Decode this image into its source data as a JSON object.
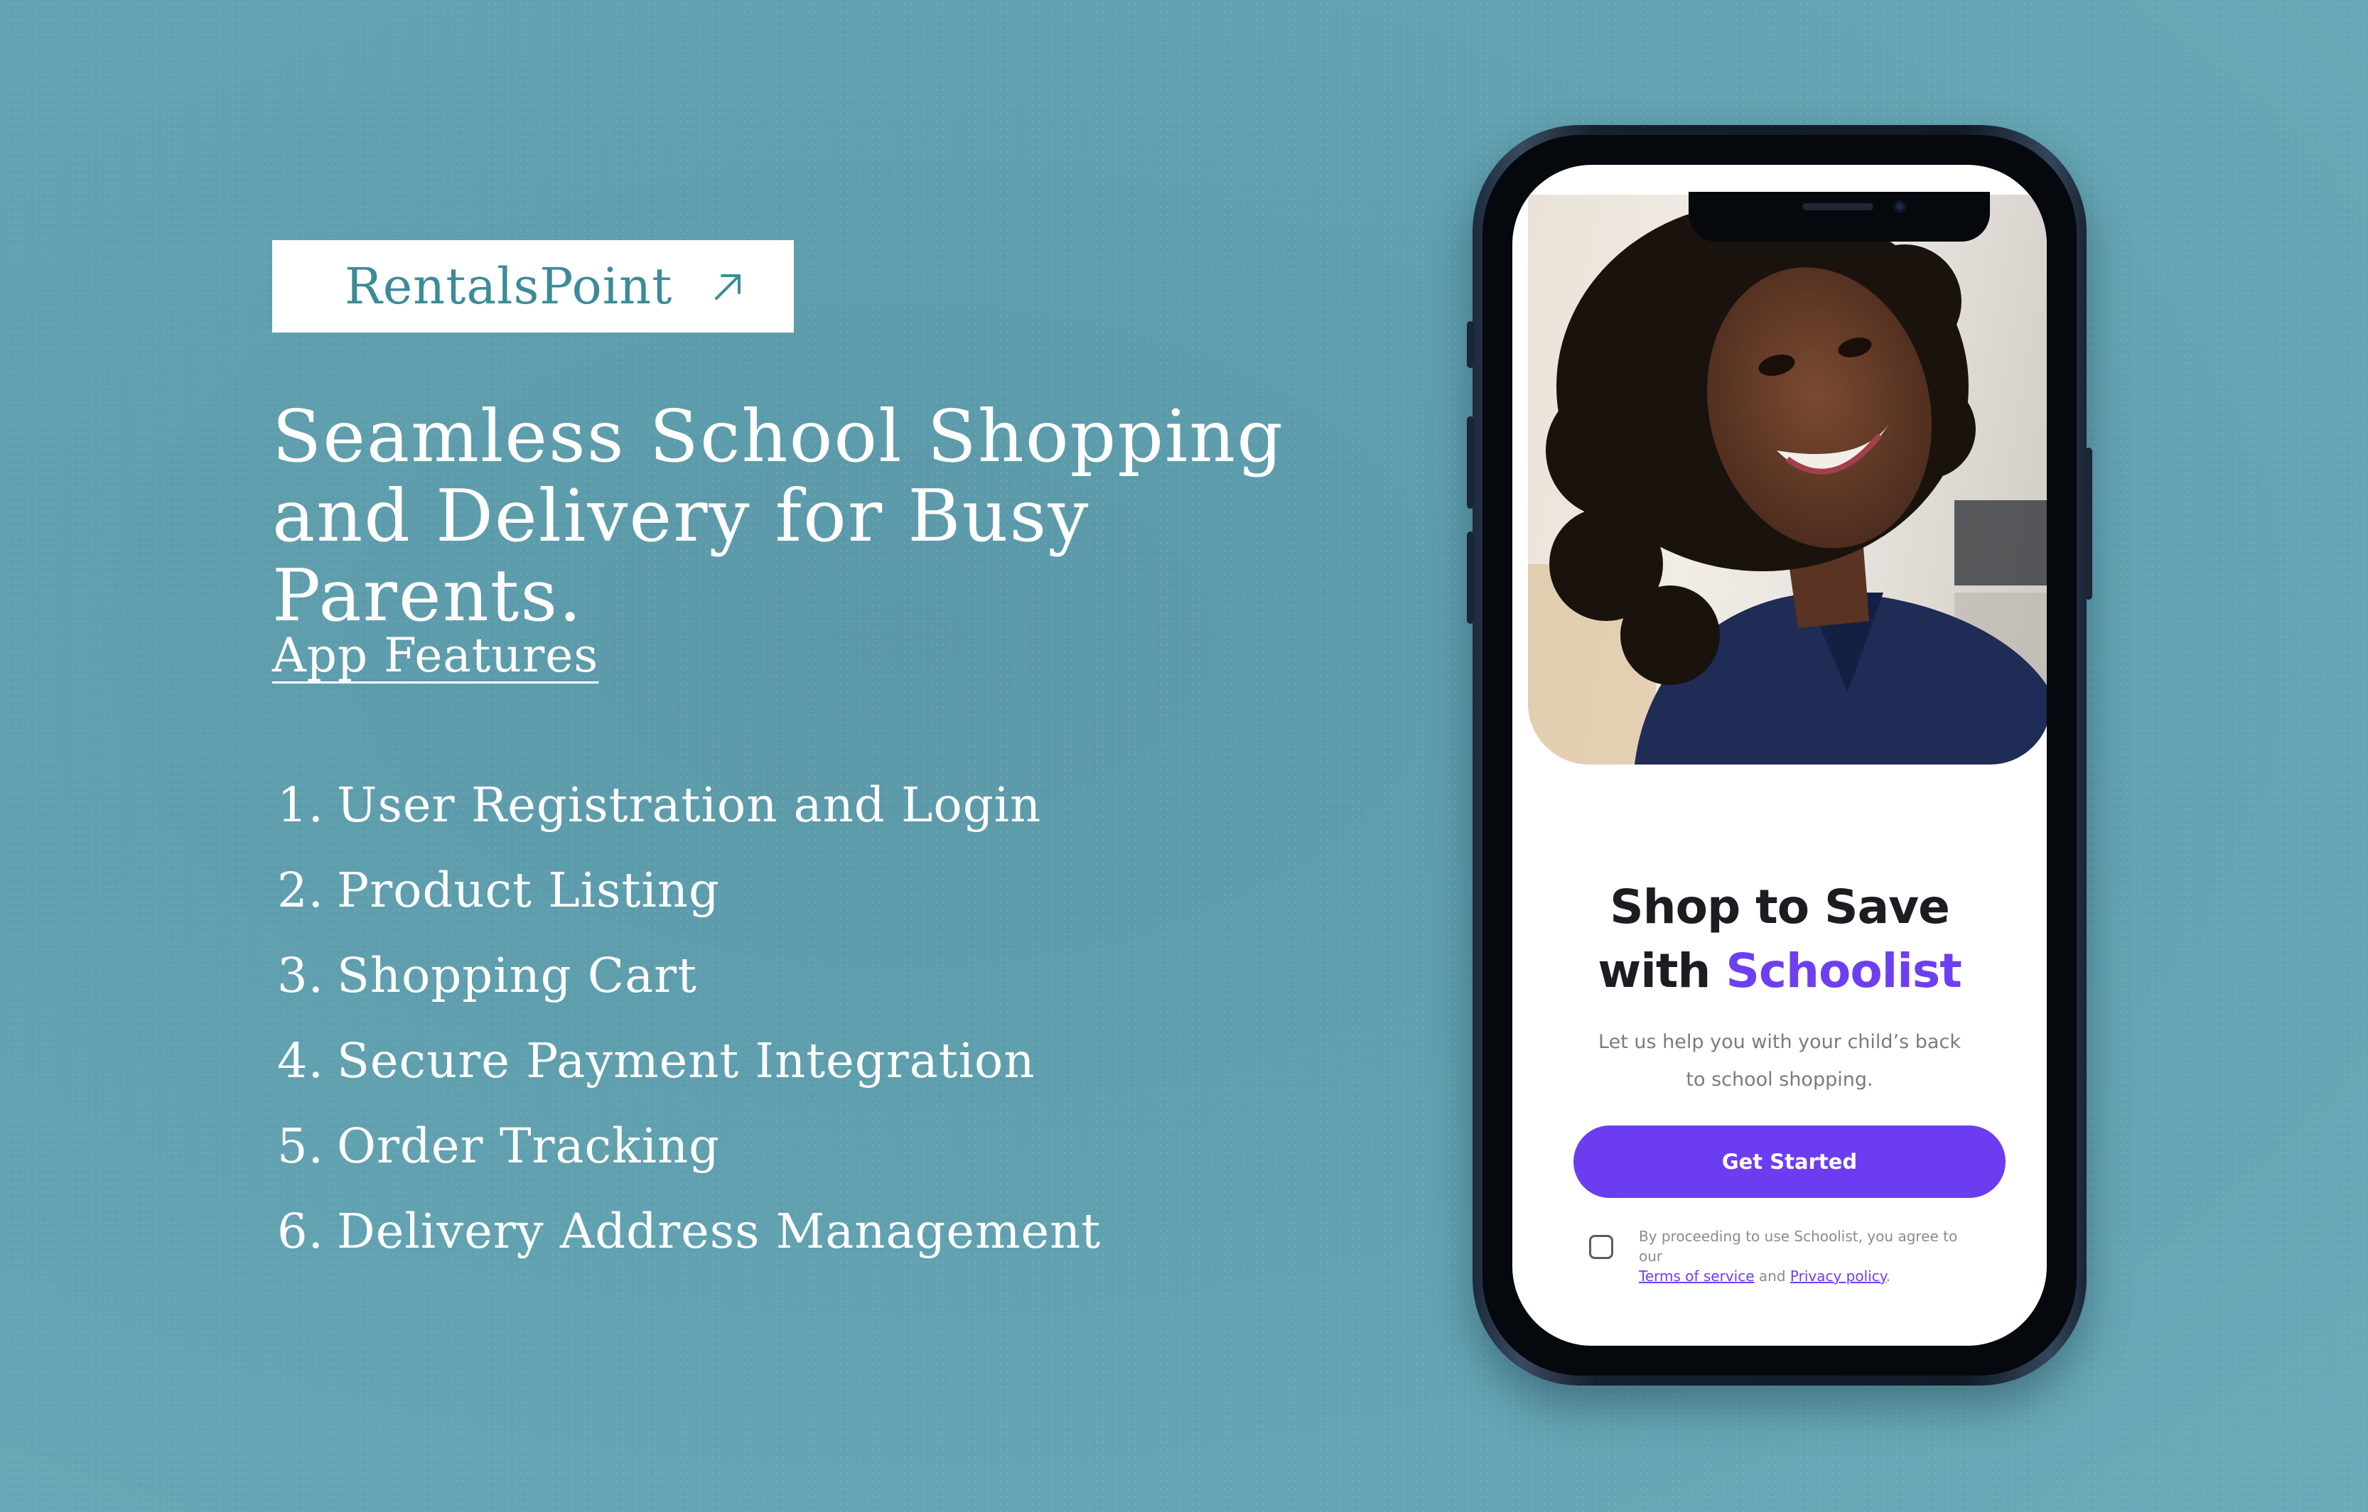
{
  "brand": {
    "name": "RentalsPoint",
    "link_icon": "arrow-up-right-icon"
  },
  "headline": "Seamless School Shopping and Delivery for Busy Parents.",
  "features": {
    "heading": "App Features",
    "items": [
      {
        "num": "1.",
        "label": "User Registration and Login"
      },
      {
        "num": "2.",
        "label": "Product Listing"
      },
      {
        "num": "3.",
        "label": "Shopping Cart"
      },
      {
        "num": "4.",
        "label": "Secure Payment Integration"
      },
      {
        "num": "5.",
        "label": "Order Tracking"
      },
      {
        "num": "6.",
        "label": "Delivery Address Management"
      }
    ]
  },
  "app": {
    "title_line1": "Shop to Save",
    "title_with": "with",
    "title_brand": "Schoolist",
    "subtitle": "Let us help you with your child’s back to school shopping.",
    "cta_label": "Get Started",
    "consent_prefix": "By proceeding to use Schoolist, you agree to our",
    "terms_label": "Terms of service",
    "consent_and": "and",
    "privacy_label": "Privacy policy",
    "consent_suffix": "."
  },
  "colors": {
    "background": "#5f9fae",
    "accent": "#6c3df0",
    "brand_text": "#3b8c98"
  }
}
